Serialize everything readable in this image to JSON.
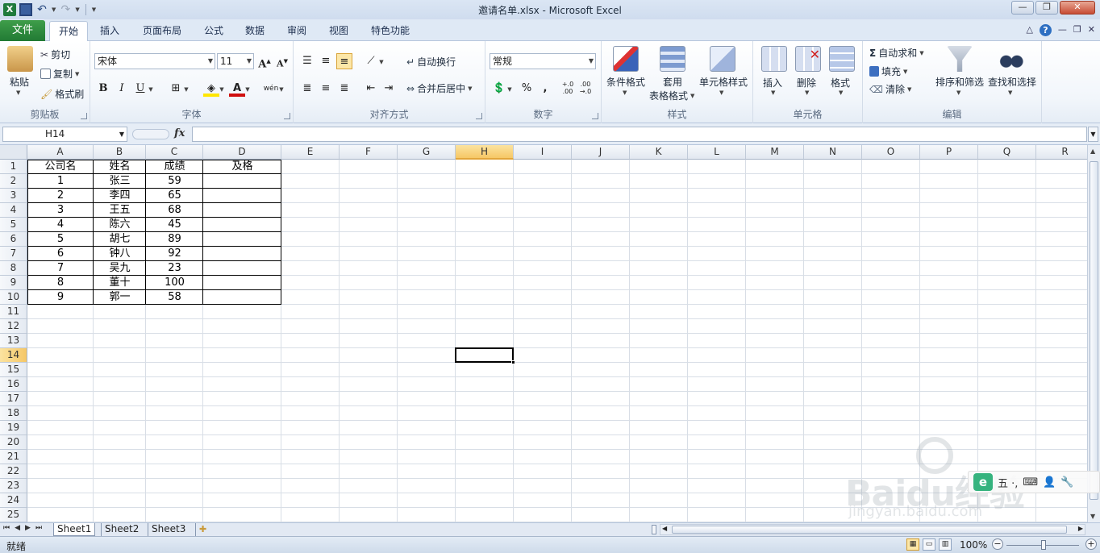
{
  "window": {
    "title": "邀请名单.xlsx  -  Microsoft Excel",
    "file_tab": "文件",
    "tabs": [
      "开始",
      "插入",
      "页面布局",
      "公式",
      "数据",
      "审阅",
      "视图",
      "特色功能"
    ],
    "active_tab": "开始"
  },
  "ribbon": {
    "clipboard": {
      "label": "剪贴板",
      "paste": "粘贴",
      "cut": "剪切",
      "copy": "复制",
      "format_painter": "格式刷"
    },
    "font": {
      "label": "字体",
      "font_name": "宋体",
      "font_size": "11",
      "bold": "B",
      "italic": "I",
      "underline": "U",
      "grow": "A",
      "shrink": "A",
      "wen": "wén"
    },
    "alignment": {
      "label": "对齐方式",
      "wrap_text": "自动换行",
      "merge_center": "合并后居中"
    },
    "number": {
      "label": "数字",
      "format": "常规",
      "percent": "%",
      "comma": ",",
      "inc_decimal": "+.0 .00",
      "dec_decimal": ".00 →.0"
    },
    "styles": {
      "label": "样式",
      "conditional": "条件格式",
      "table_format_1": "套用",
      "table_format_2": "表格格式",
      "cell_styles": "单元格样式"
    },
    "cells": {
      "label": "单元格",
      "insert": "插入",
      "delete": "删除",
      "format": "格式"
    },
    "editing": {
      "label": "编辑",
      "autosum": "自动求和",
      "fill": "填充",
      "clear": "清除",
      "sort_filter": "排序和筛选",
      "find_select": "查找和选择"
    }
  },
  "formula_bar": {
    "name_box": "H14",
    "fx": "fx",
    "formula": ""
  },
  "grid": {
    "columns": [
      "A",
      "B",
      "C",
      "D",
      "E",
      "F",
      "G",
      "H",
      "I",
      "J",
      "K",
      "L",
      "M",
      "N",
      "O",
      "P",
      "Q",
      "R"
    ],
    "rows": [
      "1",
      "2",
      "3",
      "4",
      "5",
      "6",
      "7",
      "8",
      "9",
      "10",
      "11",
      "12",
      "13",
      "14",
      "15",
      "16",
      "17",
      "18",
      "19",
      "20",
      "21",
      "22",
      "23",
      "24",
      "25"
    ],
    "selected_cell": "H14",
    "table": {
      "headers": [
        "公司名",
        "姓名",
        "成绩",
        "及格"
      ],
      "rows": [
        [
          "1",
          "张三",
          "59",
          ""
        ],
        [
          "2",
          "李四",
          "65",
          ""
        ],
        [
          "3",
          "王五",
          "68",
          ""
        ],
        [
          "4",
          "陈六",
          "45",
          ""
        ],
        [
          "5",
          "胡七",
          "89",
          ""
        ],
        [
          "6",
          "钟八",
          "92",
          ""
        ],
        [
          "7",
          "吴九",
          "23",
          ""
        ],
        [
          "8",
          "董十",
          "100",
          ""
        ],
        [
          "9",
          "郭一",
          "58",
          ""
        ]
      ]
    }
  },
  "sheets": {
    "tabs": [
      "Sheet1",
      "Sheet2",
      "Sheet3"
    ],
    "active": "Sheet1"
  },
  "status": {
    "text": "就绪",
    "zoom": "100%"
  },
  "overlay": {
    "watermark": "Baidu经验",
    "watermark_url": "jingyan.baidu.com",
    "ime_text": "五 ·,",
    "ime_logo": "e"
  },
  "colors": {
    "accent_green": "#217a34",
    "selection_header": "#f6c766"
  }
}
